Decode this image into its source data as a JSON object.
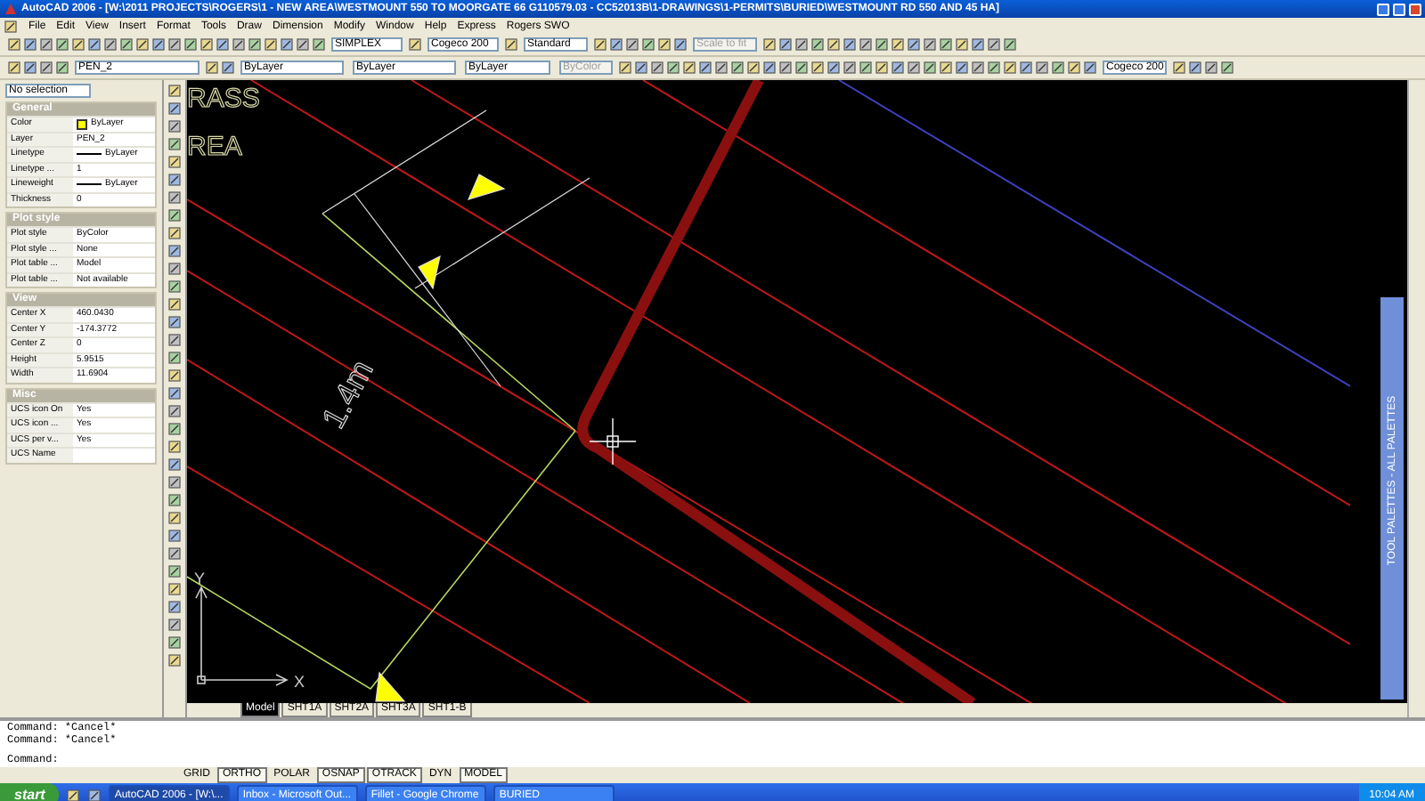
{
  "window": {
    "title": "AutoCAD 2006 - [W:\\2011 PROJECTS\\ROGERS\\1 - NEW AREA\\WESTMOUNT 550 TO MOORGATE 66 G110579.03 - CC52013B\\1-DRAWINGS\\1-PERMITS\\BURIED\\WESTMOUNT RD 550 AND 45 HA]"
  },
  "menu": [
    "File",
    "Edit",
    "View",
    "Insert",
    "Format",
    "Tools",
    "Draw",
    "Dimension",
    "Modify",
    "Window",
    "Help",
    "Express",
    "Rogers SWO"
  ],
  "toolbar_dropdowns": [
    {
      "value": "SIMPLEX",
      "disabled": false
    },
    {
      "value": "Cogeco 200",
      "disabled": false
    },
    {
      "value": "Standard",
      "disabled": false
    },
    {
      "value": "Scale to fit",
      "disabled": true
    }
  ],
  "layer_toolbar": {
    "layer": "PEN_2",
    "color_setting": "ByLayer",
    "linetype": "ByLayer",
    "lineweight": "ByLayer",
    "plotstyle": "ByColor",
    "plotstyle_disabled": true,
    "dimstyle": "Cogeco 200"
  },
  "properties": {
    "selection": "No selection",
    "sections": [
      {
        "title": "General",
        "rows": [
          {
            "label": "Color",
            "value": "ByLayer",
            "kind": "color"
          },
          {
            "label": "Layer",
            "value": "PEN_2",
            "kind": "text"
          },
          {
            "label": "Linetype",
            "value": "ByLayer",
            "kind": "line"
          },
          {
            "label": "Linetype ...",
            "value": "1",
            "kind": "text"
          },
          {
            "label": "Lineweight",
            "value": "ByLayer",
            "kind": "line"
          },
          {
            "label": "Thickness",
            "value": "0",
            "kind": "text"
          }
        ]
      },
      {
        "title": "Plot style",
        "rows": [
          {
            "label": "Plot style",
            "value": "ByColor",
            "kind": "text"
          },
          {
            "label": "Plot style ...",
            "value": "None",
            "kind": "text"
          },
          {
            "label": "Plot table ...",
            "value": "Model",
            "kind": "text"
          },
          {
            "label": "Plot table ...",
            "value": "Not available",
            "kind": "text"
          }
        ]
      },
      {
        "title": "View",
        "rows": [
          {
            "label": "Center X",
            "value": "460.0430",
            "kind": "text"
          },
          {
            "label": "Center Y",
            "value": "-174.3772",
            "kind": "text"
          },
          {
            "label": "Center Z",
            "value": "0",
            "kind": "text"
          },
          {
            "label": "Height",
            "value": "5.9515",
            "kind": "text"
          },
          {
            "label": "Width",
            "value": "11.6904",
            "kind": "text"
          }
        ]
      },
      {
        "title": "Misc",
        "rows": [
          {
            "label": "UCS icon On",
            "value": "Yes",
            "kind": "text"
          },
          {
            "label": "UCS icon ...",
            "value": "Yes",
            "kind": "text"
          },
          {
            "label": "UCS per v...",
            "value": "Yes",
            "kind": "text"
          },
          {
            "label": "UCS Name",
            "value": "",
            "kind": "text"
          }
        ]
      }
    ]
  },
  "drawing": {
    "texts": [
      "RASS",
      "REA"
    ],
    "dimension": "1.4m",
    "ucs_x": "X",
    "ucs_y": "Y"
  },
  "layout_tabs": [
    {
      "label": "Model",
      "selected": true
    },
    {
      "label": "SHT1A",
      "selected": false
    },
    {
      "label": "SHT2A",
      "selected": false
    },
    {
      "label": "SHT3A",
      "selected": false
    },
    {
      "label": "SHT1-B",
      "selected": false
    }
  ],
  "tool_palette": {
    "title": "TOOL PALETTES - ALL PALETTES"
  },
  "command_lines": [
    "Command: *Cancel*",
    "Command: *Cancel*"
  ],
  "command_prompt": "Command:",
  "status_buttons": [
    {
      "label": "GRID",
      "on": false
    },
    {
      "label": "ORTHO",
      "on": true
    },
    {
      "label": "POLAR",
      "on": false
    },
    {
      "label": "OSNAP",
      "on": true
    },
    {
      "label": "OTRACK",
      "on": true
    },
    {
      "label": "DYN",
      "on": false
    },
    {
      "label": "MODEL",
      "on": true
    }
  ],
  "taskbar": {
    "start": "start",
    "tasks": [
      {
        "label": "AutoCAD 2006 - [W:\\...",
        "selected": true
      },
      {
        "label": "Inbox - Microsoft Out...",
        "selected": false
      },
      {
        "label": "Fillet - Google Chrome",
        "selected": false
      },
      {
        "label": "BURIED",
        "selected": false
      }
    ],
    "clock": "10:04 AM"
  }
}
